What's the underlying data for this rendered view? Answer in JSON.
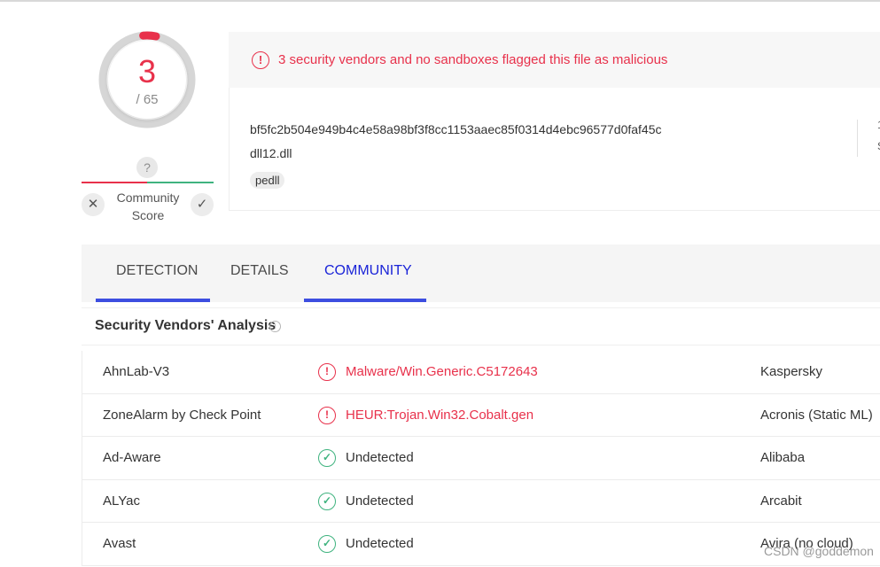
{
  "score": {
    "detections": "3",
    "total": "/ 65",
    "fraction": 0.046,
    "accent_color": "#e8314b"
  },
  "community": {
    "question": "?",
    "label_line1": "Community",
    "label_line2": "Score",
    "vote_down_icon": "close-icon",
    "vote_up_icon": "check-icon"
  },
  "alert": {
    "icon": "!",
    "text": "3 security vendors and no sandboxes flagged this file as malicious"
  },
  "file": {
    "hash": "bf5fc2b504e949b4c4e58a98bf3f8cc1153aaec85f0314d4ebc96577d0faf45c",
    "name": "dll12.dll",
    "tag": "pedll"
  },
  "tabs": [
    {
      "label": "DETECTION",
      "active": false
    },
    {
      "label": "DETAILS",
      "active": false
    },
    {
      "label": "COMMUNITY",
      "active": true
    }
  ],
  "section": {
    "title": "Security Vendors' Analysis",
    "info_icon": "i"
  },
  "vendors": [
    {
      "vendor": "AhnLab-V3",
      "status": "malicious",
      "result": "Malware/Win.Generic.C5172643",
      "vendor2": "Kaspersky"
    },
    {
      "vendor": "ZoneAlarm by Check Point",
      "status": "malicious",
      "result": "HEUR:Trojan.Win32.Cobalt.gen",
      "vendor2": "Acronis (Static ML)"
    },
    {
      "vendor": "Ad-Aware",
      "status": "clean",
      "result": "Undetected",
      "vendor2": "Alibaba"
    },
    {
      "vendor": "ALYac",
      "status": "clean",
      "result": "Undetected",
      "vendor2": "Arcabit"
    },
    {
      "vendor": "Avast",
      "status": "clean",
      "result": "Undetected",
      "vendor2": "Avira (no cloud)"
    }
  ],
  "status_icons": {
    "malicious": "!",
    "clean": "✓"
  },
  "watermark": "CSDN @goddemon"
}
